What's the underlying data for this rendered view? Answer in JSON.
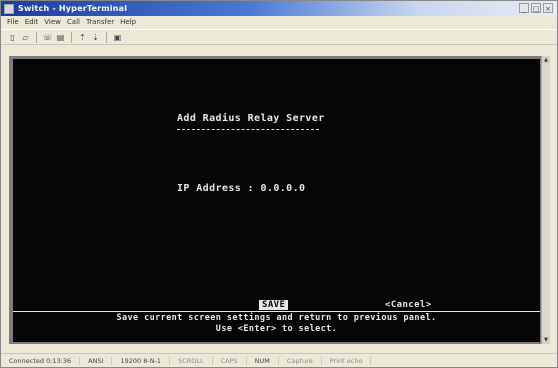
{
  "window": {
    "title": "Switch - HyperTerminal"
  },
  "menu": [
    "File",
    "Edit",
    "View",
    "Call",
    "Transfer",
    "Help"
  ],
  "toolbar": {
    "icons": [
      "new-icon",
      "open-icon",
      "disconnect-icon",
      "properties-icon",
      "send-icon",
      "receive-icon",
      "capture-icon"
    ]
  },
  "terminal": {
    "heading": "Add Radius Relay Server",
    "field_label": "IP Address",
    "field_value": "0.0.0.0",
    "save_label": "SAVE",
    "cancel_label": "<Cancel>",
    "hint_line1": "Save current screen settings and return to previous panel.",
    "hint_line2": "Use <Enter> to select."
  },
  "status": {
    "connected": "Connected 0:13:36",
    "emulation": "ANSI",
    "port": "19200 8-N-1",
    "scroll": "SCROLL",
    "caps": "CAPS",
    "num": "NUM",
    "capture": "Capture",
    "printecho": "Print echo"
  }
}
